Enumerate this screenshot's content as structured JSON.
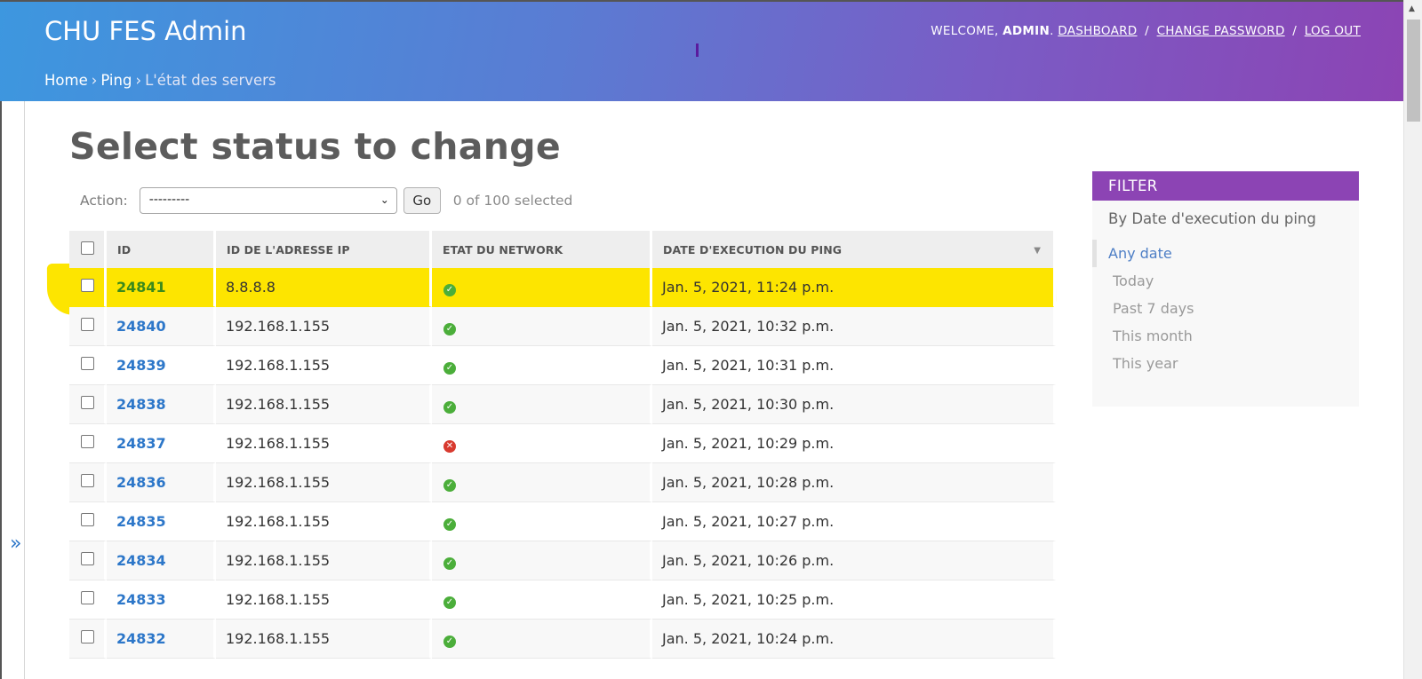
{
  "header": {
    "brand": "CHU FES Admin",
    "welcome": "WELCOME,",
    "user": "ADMIN",
    "dashboard": "DASHBOARD",
    "change_password": "CHANGE PASSWORD",
    "logout": "LOG OUT",
    "separator": "/"
  },
  "breadcrumbs": {
    "home": "Home",
    "app": "Ping",
    "current": "L'état des servers",
    "arrow": "›"
  },
  "page": {
    "title": "Select status to change",
    "nav_toggle": "»"
  },
  "actions": {
    "label": "Action:",
    "selected_option": "---------",
    "go": "Go",
    "counter": "0 of 100 selected"
  },
  "table": {
    "columns": [
      "ID",
      "ID DE L'ADRESSE IP",
      "ETAT DU NETWORK",
      "DATE D'EXECUTION DU PING"
    ],
    "rows": [
      {
        "id": "24841",
        "ip": "8.8.8.8",
        "status": "ok",
        "date": "Jan. 5, 2021, 11:24 p.m."
      },
      {
        "id": "24840",
        "ip": "192.168.1.155",
        "status": "ok",
        "date": "Jan. 5, 2021, 10:32 p.m."
      },
      {
        "id": "24839",
        "ip": "192.168.1.155",
        "status": "ok",
        "date": "Jan. 5, 2021, 10:31 p.m."
      },
      {
        "id": "24838",
        "ip": "192.168.1.155",
        "status": "ok",
        "date": "Jan. 5, 2021, 10:30 p.m."
      },
      {
        "id": "24837",
        "ip": "192.168.1.155",
        "status": "error",
        "date": "Jan. 5, 2021, 10:29 p.m."
      },
      {
        "id": "24836",
        "ip": "192.168.1.155",
        "status": "ok",
        "date": "Jan. 5, 2021, 10:28 p.m."
      },
      {
        "id": "24835",
        "ip": "192.168.1.155",
        "status": "ok",
        "date": "Jan. 5, 2021, 10:27 p.m."
      },
      {
        "id": "24834",
        "ip": "192.168.1.155",
        "status": "ok",
        "date": "Jan. 5, 2021, 10:26 p.m."
      },
      {
        "id": "24833",
        "ip": "192.168.1.155",
        "status": "ok",
        "date": "Jan. 5, 2021, 10:25 p.m."
      },
      {
        "id": "24832",
        "ip": "192.168.1.155",
        "status": "ok",
        "date": "Jan. 5, 2021, 10:24 p.m."
      }
    ]
  },
  "filter": {
    "heading": "FILTER",
    "subtitle": "By Date d'execution du ping",
    "options": [
      "Any date",
      "Today",
      "Past 7 days",
      "This month",
      "This year"
    ],
    "selected": "Any date"
  },
  "colors": {
    "header_start": "#3d97df",
    "header_end": "#8c44b4",
    "link": "#2d77c9",
    "highlight": "#fde500",
    "ok": "#4bae3a",
    "error": "#d83a2f"
  }
}
